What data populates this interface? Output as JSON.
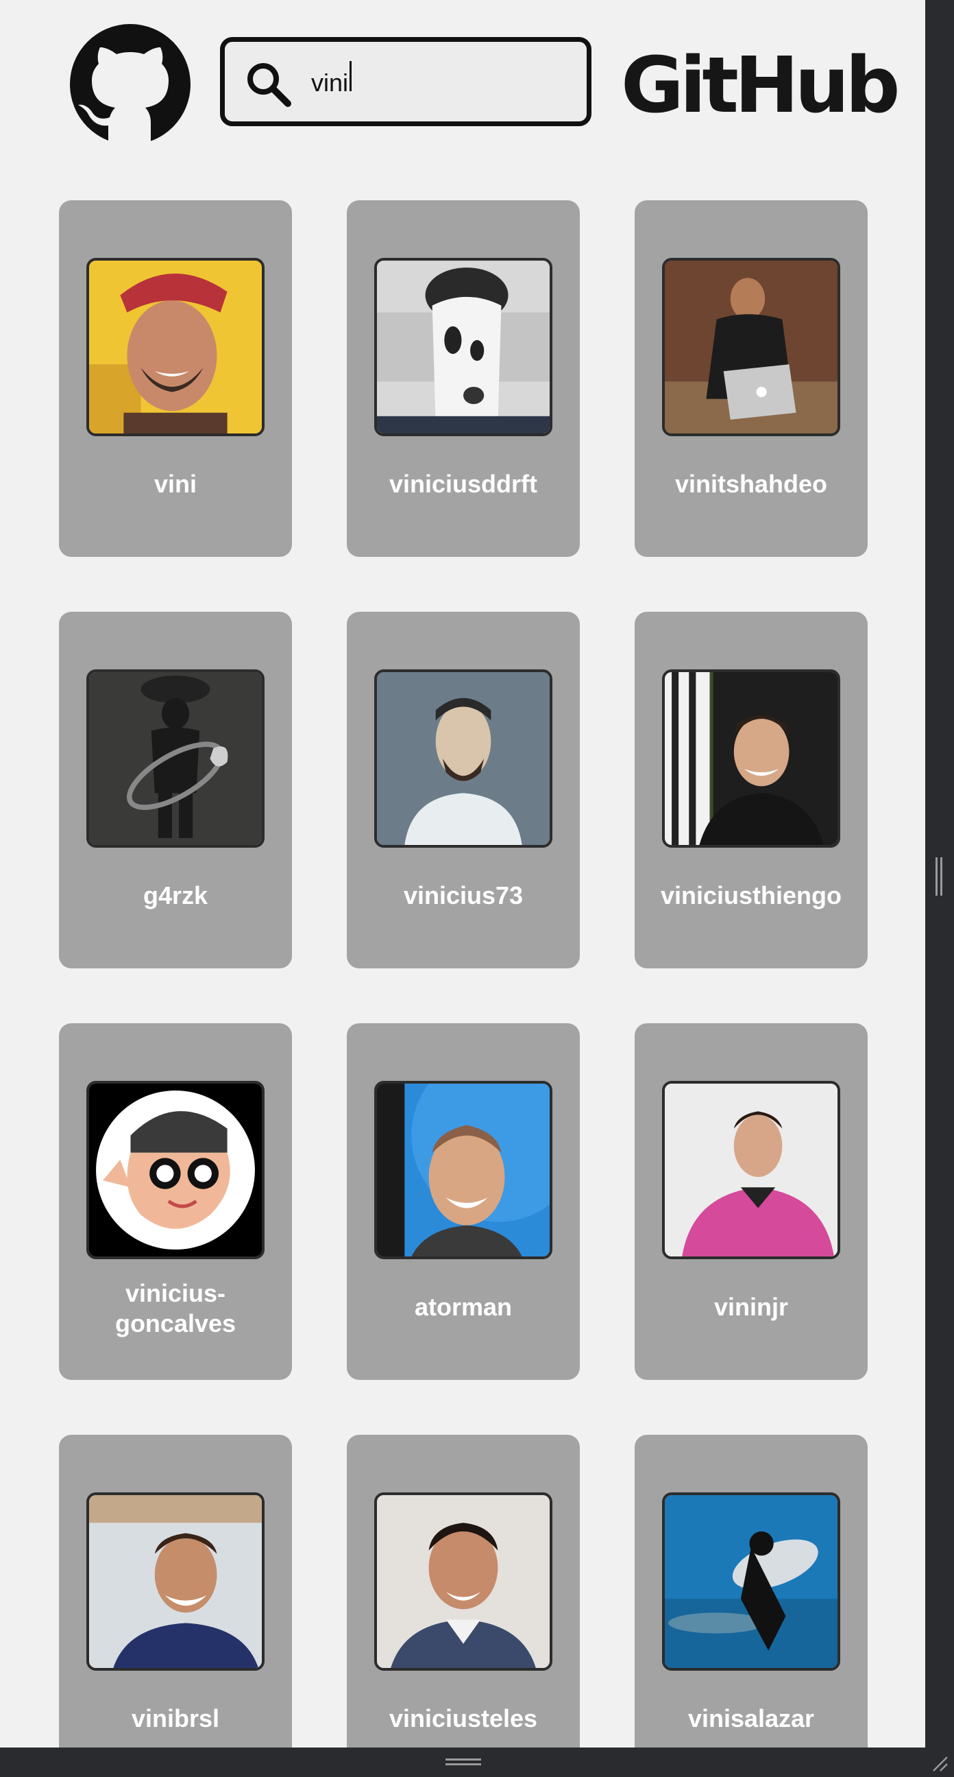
{
  "header": {
    "logo_icon": "github-octocat-icon",
    "search": {
      "icon": "search-icon",
      "value": "vini",
      "placeholder": ""
    },
    "brand": "GitHub"
  },
  "users": [
    {
      "login": "vini"
    },
    {
      "login": "viniciusddrft"
    },
    {
      "login": "vinitshahdeo"
    },
    {
      "login": "g4rzk"
    },
    {
      "login": "vinicius73"
    },
    {
      "login": "viniciusthiengo"
    },
    {
      "login": "vinicius-goncalves"
    },
    {
      "login": "atorman"
    },
    {
      "login": "vininjr"
    },
    {
      "login": "vinibrsl"
    },
    {
      "login": "viniciusteles"
    },
    {
      "login": "vinisalazar"
    }
  ],
  "colors": {
    "page_bg": "#f1f1f1",
    "card_bg": "#a3a3a3",
    "username": "#ffffff",
    "chrome": "#2a2b2f"
  }
}
